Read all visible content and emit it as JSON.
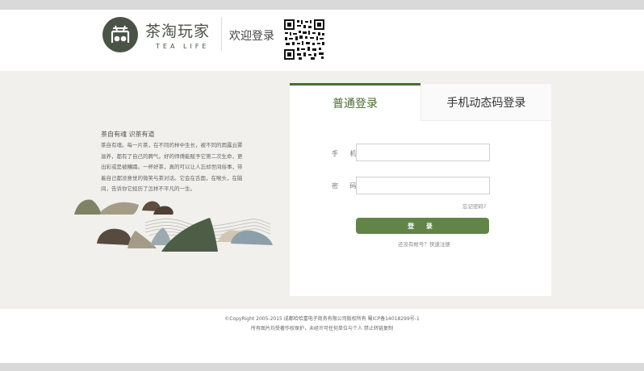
{
  "header": {
    "logo_cn": "茶淘玩家",
    "logo_en": "TEA LIFE",
    "welcome": "欢迎登录"
  },
  "intro": {
    "title": "茶自有魂 识茶有道",
    "text": "茶自有魂。每一片茶，在不同的林中生长，被不同的雨露云雾滋养，都有了自己的脾气。好的师傅能赋予它第二次生命，更出彩或是被糟蹋。一杯好茶，真的可以让人忘却世间俗事，带着自己都没意觉的微笑与茶对话。它会在舌面，在喉头，在脑间，告诉你它经历了怎样不平凡的一生。"
  },
  "login": {
    "tab_normal": "普通登录",
    "tab_sms": "手机动态码登录",
    "phone_label": "手 机",
    "password_label": "密 码",
    "phone_value": "",
    "password_value": "",
    "forgot": "忘记密码?",
    "submit": "登 录",
    "register": "还没有帐号？快速注册"
  },
  "footer": {
    "line1": "©CopyRight 2005-2015 成都哈哈富电子商务有限公司版权所有 蜀ICP备14018299号-1",
    "line2": "所有图片均受著作权保护，未经许可任何单位与个人 禁止转链复制"
  },
  "colors": {
    "accent": "#628449",
    "logo": "#4b5347",
    "main_bg": "#f1f0ec"
  }
}
